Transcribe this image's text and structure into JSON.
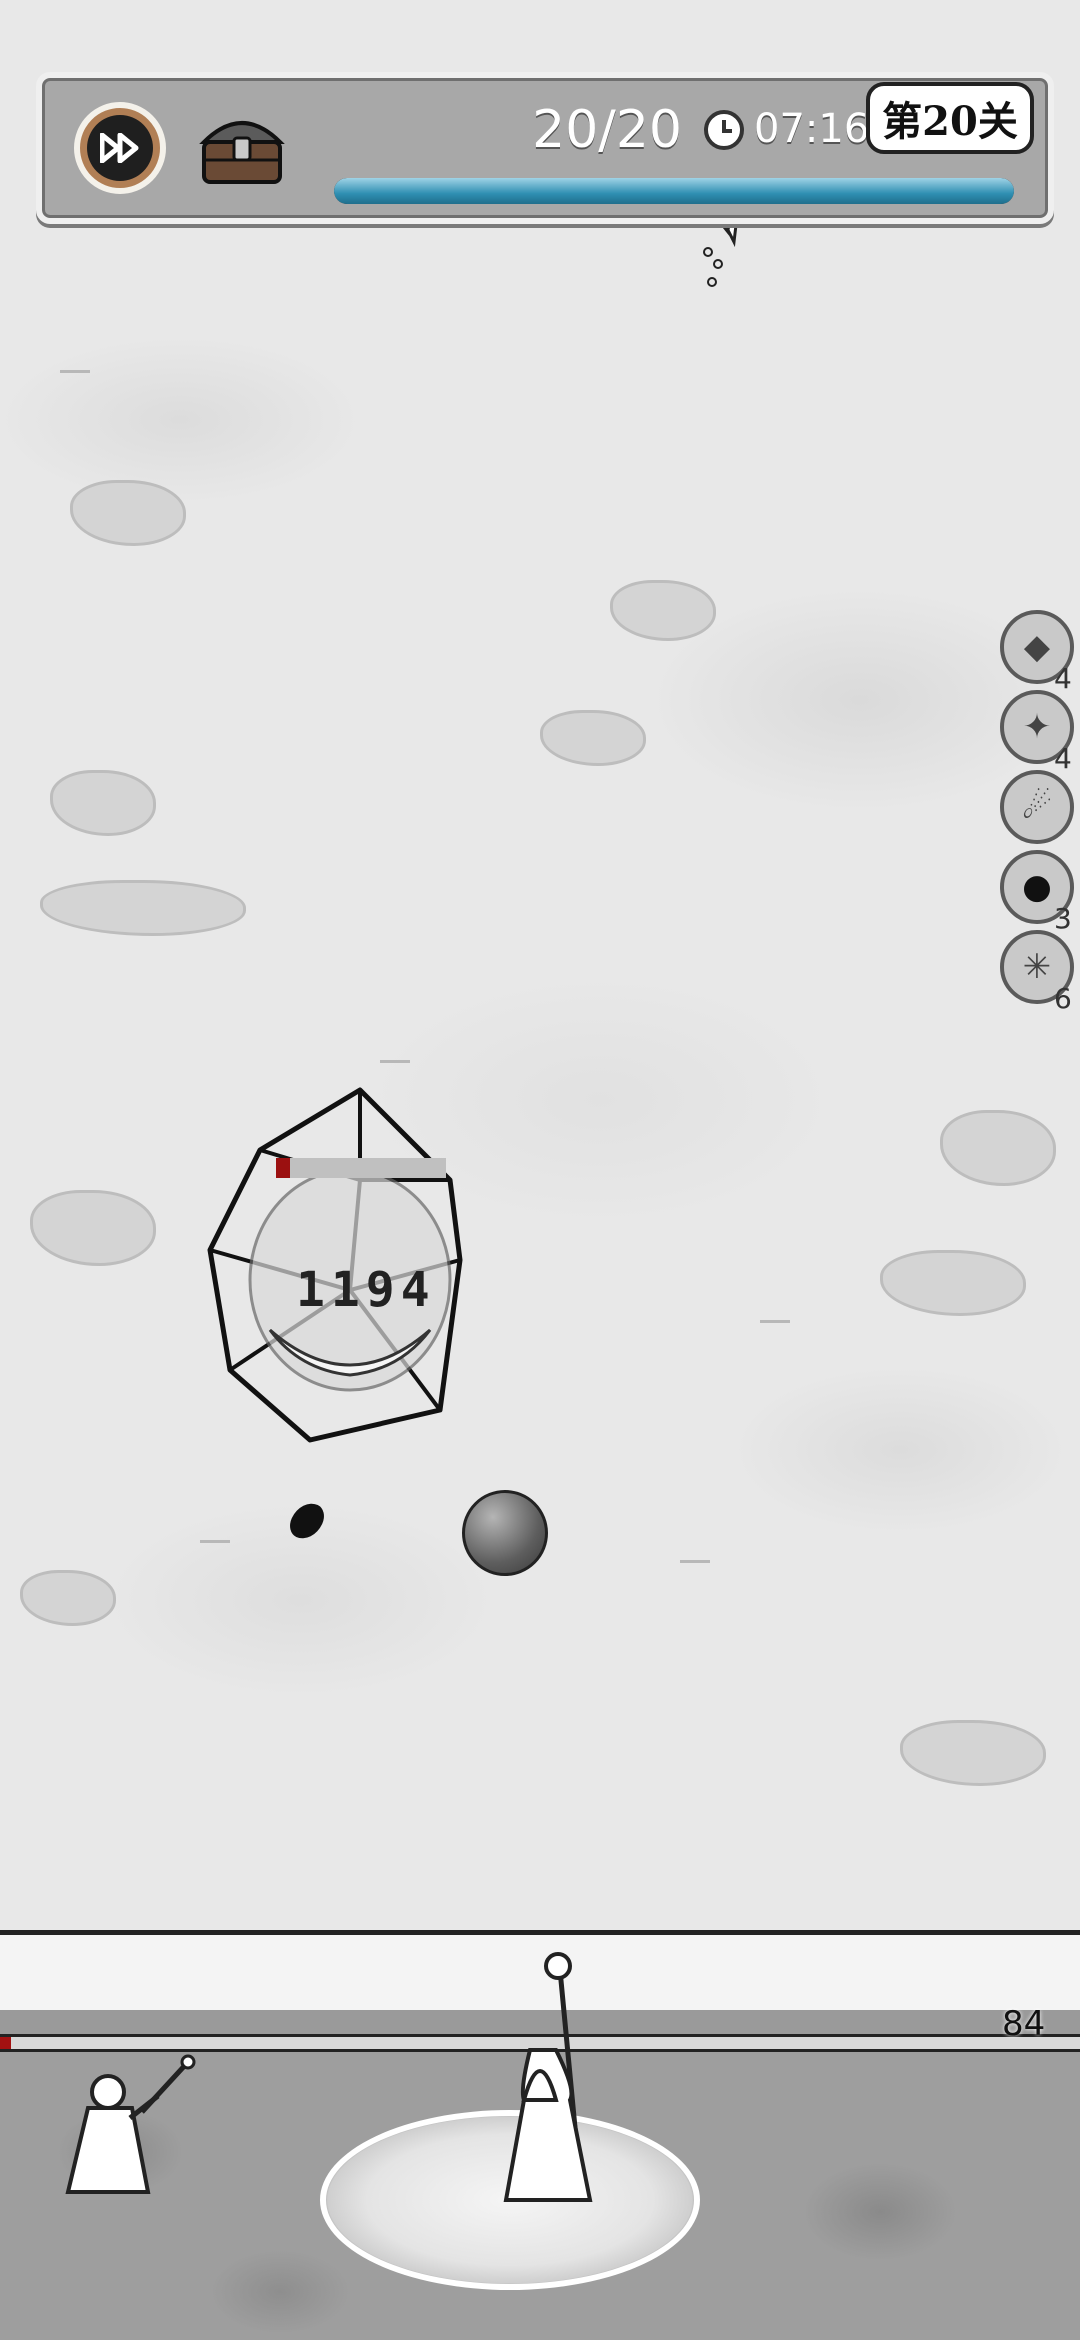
{
  "hud": {
    "wave": "20/20",
    "time": "07:16",
    "level": "第20关",
    "wave_progress": 1.0
  },
  "skills": [
    {
      "icon": "crystal-shard-icon",
      "count": "4"
    },
    {
      "icon": "lightning-crack-icon",
      "count": "4"
    },
    {
      "icon": "meteor-icon",
      "count": ""
    },
    {
      "icon": "bomb-icon",
      "count": "3"
    },
    {
      "icon": "ice-burst-icon",
      "count": "6"
    }
  ],
  "enemy": {
    "damage_number": "1194",
    "hp_fraction": 0.08
  },
  "base": {
    "hp": "84",
    "hp_fraction": 0.01
  },
  "colors": {
    "hp_red": "#9b1010",
    "progress_blue": "#2f8fb2",
    "ff_button": "#b17f55"
  }
}
